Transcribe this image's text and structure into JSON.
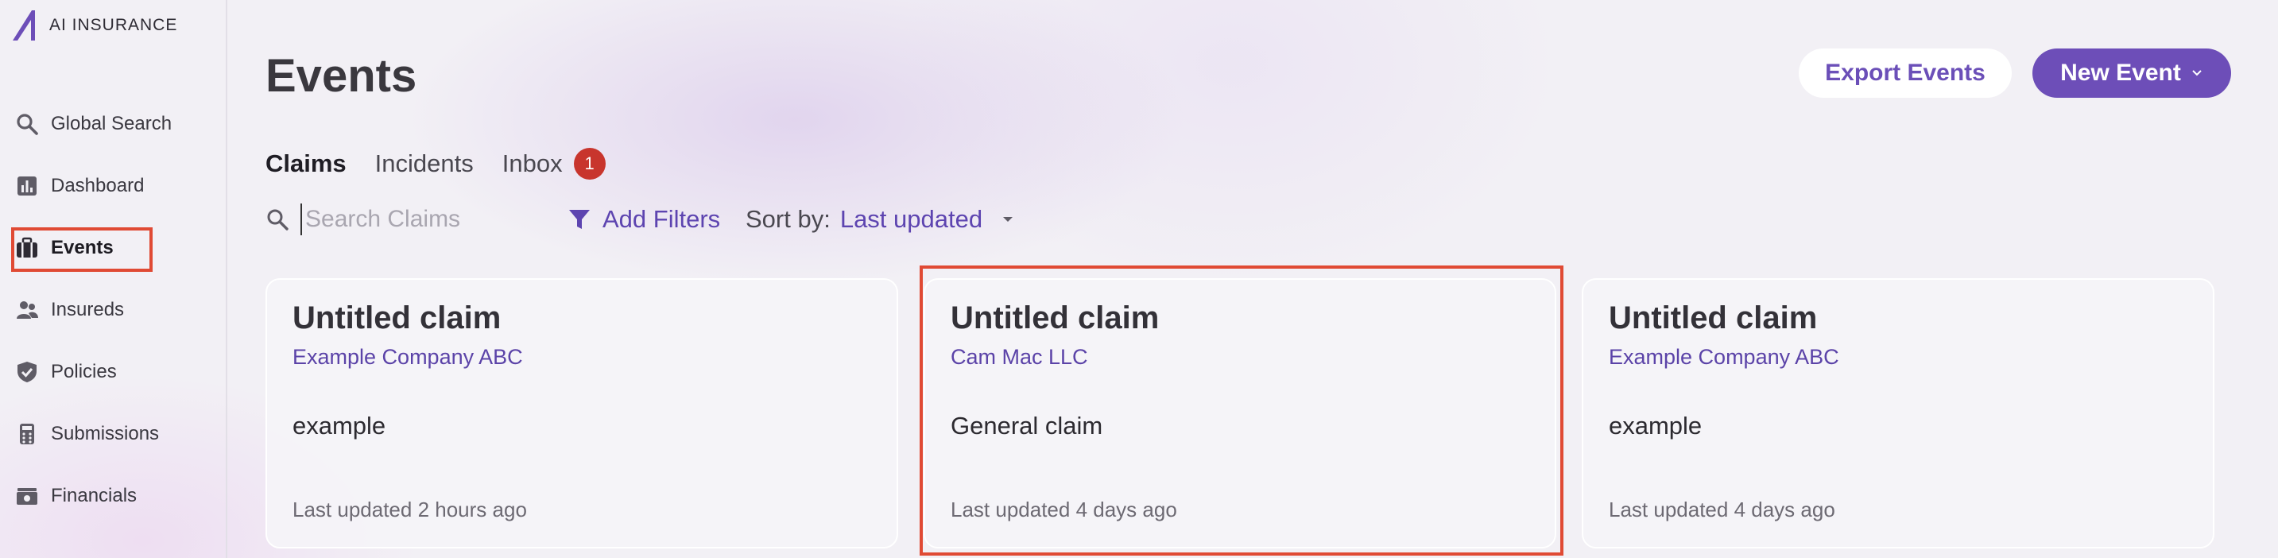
{
  "app": {
    "brand": "AI INSURANCE"
  },
  "sidebar": {
    "items": [
      {
        "label": "Global Search",
        "icon": "search-icon"
      },
      {
        "label": "Dashboard",
        "icon": "chart-icon"
      },
      {
        "label": "Events",
        "icon": "briefcase-icon",
        "active": true
      },
      {
        "label": "Insureds",
        "icon": "people-icon"
      },
      {
        "label": "Policies",
        "icon": "shield-icon"
      },
      {
        "label": "Submissions",
        "icon": "calculator-icon"
      },
      {
        "label": "Financials",
        "icon": "money-icon"
      }
    ]
  },
  "header": {
    "title": "Events",
    "export_label": "Export Events",
    "new_label": "New Event"
  },
  "tabs": [
    {
      "label": "Claims",
      "active": true
    },
    {
      "label": "Incidents"
    },
    {
      "label": "Inbox",
      "badge": "1"
    }
  ],
  "search": {
    "placeholder": "Search Claims",
    "value": ""
  },
  "filters": {
    "label": "Add Filters"
  },
  "sort": {
    "label": "Sort by:",
    "value": "Last updated"
  },
  "cards": [
    {
      "title": "Untitled claim",
      "company": "Example Company ABC",
      "description": "example",
      "updated": "Last updated 2 hours ago"
    },
    {
      "title": "Untitled claim",
      "company": "Cam Mac LLC",
      "description": "General claim",
      "updated": "Last updated 4 days ago"
    },
    {
      "title": "Untitled claim",
      "company": "Example Company ABC",
      "description": "example",
      "updated": "Last updated 4 days ago"
    }
  ],
  "colors": {
    "accent": "#6d4eb8",
    "link": "#5b43a8",
    "badge": "#c8352d",
    "highlight_outline": "#e04a34",
    "background": "#f2f0f5"
  }
}
